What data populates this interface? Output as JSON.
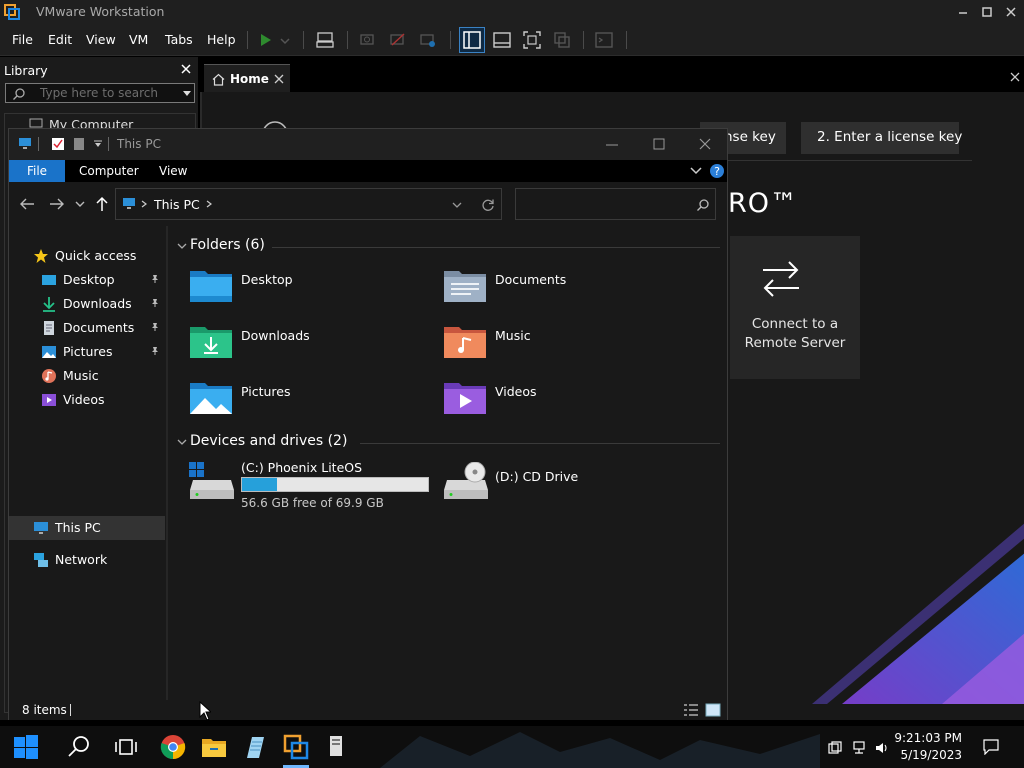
{
  "vmware": {
    "title": "VMware Workstation",
    "menu": [
      "File",
      "Edit",
      "View",
      "VM",
      "Tabs",
      "Help"
    ],
    "library": {
      "title": "Library",
      "search_placeholder": "Type here to search",
      "tree_first_item": "My Computer"
    },
    "home_tab_label": "Home",
    "license_buttons": [
      "nse key",
      "2. Enter a license key"
    ],
    "pro_text": "RO™",
    "remote_card_label": "Connect to a Remote Server"
  },
  "explorer": {
    "title": "This PC",
    "ribbon_tabs": [
      "File",
      "Computer",
      "View"
    ],
    "address_path": "This PC",
    "search_placeholder": "",
    "nav": {
      "quick_access": "Quick access",
      "quick_items": [
        {
          "label": "Desktop",
          "icon": "desktop-folder-icon",
          "pinned": true
        },
        {
          "label": "Downloads",
          "icon": "downloads-folder-icon",
          "pinned": true
        },
        {
          "label": "Documents",
          "icon": "documents-folder-icon",
          "pinned": true
        },
        {
          "label": "Pictures",
          "icon": "pictures-folder-icon",
          "pinned": true
        },
        {
          "label": "Music",
          "icon": "music-folder-icon",
          "pinned": false
        },
        {
          "label": "Videos",
          "icon": "videos-folder-icon",
          "pinned": false
        }
      ],
      "this_pc": "This PC",
      "network": "Network"
    },
    "folders_header": "Folders (6)",
    "folders": [
      {
        "label": "Desktop",
        "icon": "desktop-folder-icon"
      },
      {
        "label": "Documents",
        "icon": "documents-folder-icon"
      },
      {
        "label": "Downloads",
        "icon": "downloads-folder-icon"
      },
      {
        "label": "Music",
        "icon": "music-folder-icon"
      },
      {
        "label": "Pictures",
        "icon": "pictures-folder-icon"
      },
      {
        "label": "Videos",
        "icon": "videos-folder-icon"
      }
    ],
    "drives_header": "Devices and drives (2)",
    "drives": [
      {
        "label": "(C:) Phoenix LiteOS",
        "free_text": "56.6 GB free of 69.9 GB",
        "used_fraction": 0.19
      },
      {
        "label": "(D:) CD Drive"
      }
    ],
    "status_text": "8 items"
  },
  "taskbar": {
    "apps": [
      "start-icon",
      "search-icon",
      "task-view-icon",
      "chrome-icon",
      "file-explorer-icon",
      "notepad-icon",
      "vmware-icon",
      "server-icon"
    ],
    "time": "9:21:03 PM",
    "date": "5/19/2023"
  },
  "colors": {
    "accent": "#1a73c9",
    "drive_fill": "#26a0da",
    "background_dark": "#191919"
  }
}
